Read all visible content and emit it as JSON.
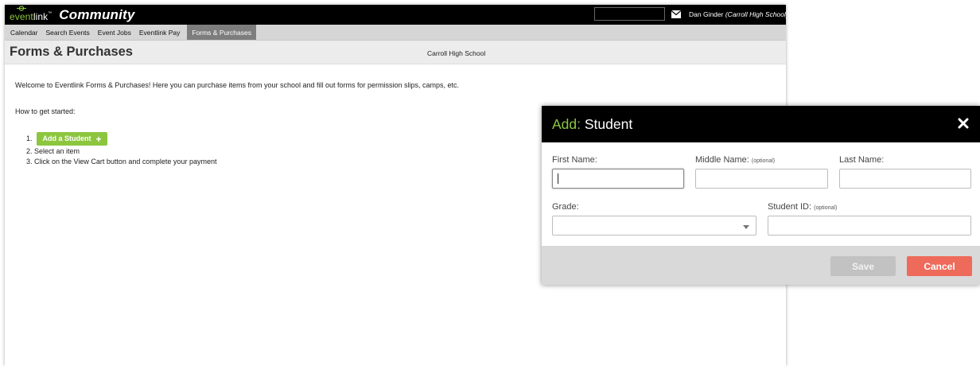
{
  "header": {
    "logo_prefix": "event",
    "logo_suffix": "link",
    "logo_tm": "™",
    "brand": "Community",
    "user_name": "Dan Ginder",
    "user_school": "(Carroll High School)",
    "icons": {
      "logo": "eventlink-logo-icon",
      "mail": "mail-icon",
      "caret": "chevron-down-icon"
    }
  },
  "nav": {
    "items": [
      {
        "label": "Calendar"
      },
      {
        "label": "Search Events"
      },
      {
        "label": "Event Jobs"
      },
      {
        "label": "Eventlink Pay"
      },
      {
        "label": "Forms & Purchases",
        "active": true
      }
    ]
  },
  "page": {
    "title": "Forms & Purchases",
    "school": "Carroll High School",
    "welcome": "Welcome to Eventlink Forms & Purchases! Here you can purchase items from your school and fill out forms for permission slips, camps, etc.",
    "how_to": "How to get started:",
    "steps": [
      {
        "number": "1.",
        "button_label": "Add a Student",
        "button_icon": "+"
      },
      {
        "text": "2. Select an item"
      },
      {
        "text": "3. Click on the View Cart button and complete your payment"
      }
    ]
  },
  "modal": {
    "title_prefix": "Add:",
    "title": "Student",
    "close_icon": "close-icon",
    "fields": {
      "first_name": {
        "label": "First Name:",
        "value": ""
      },
      "middle_name": {
        "label": "Middle Name:",
        "optional": "(optional)",
        "value": ""
      },
      "last_name": {
        "label": "Last Name:",
        "value": ""
      },
      "grade": {
        "label": "Grade:",
        "value": ""
      },
      "student_id": {
        "label": "Student ID:",
        "optional": "(optional)",
        "value": ""
      }
    },
    "buttons": {
      "save": "Save",
      "cancel": "Cancel"
    }
  },
  "colors": {
    "brand_green": "#8cc63f",
    "cancel_red": "#ee6a5a",
    "save_disabled": "#c2c2c2",
    "top_bar": "#000000",
    "active_tab": "#7d7d7d"
  }
}
